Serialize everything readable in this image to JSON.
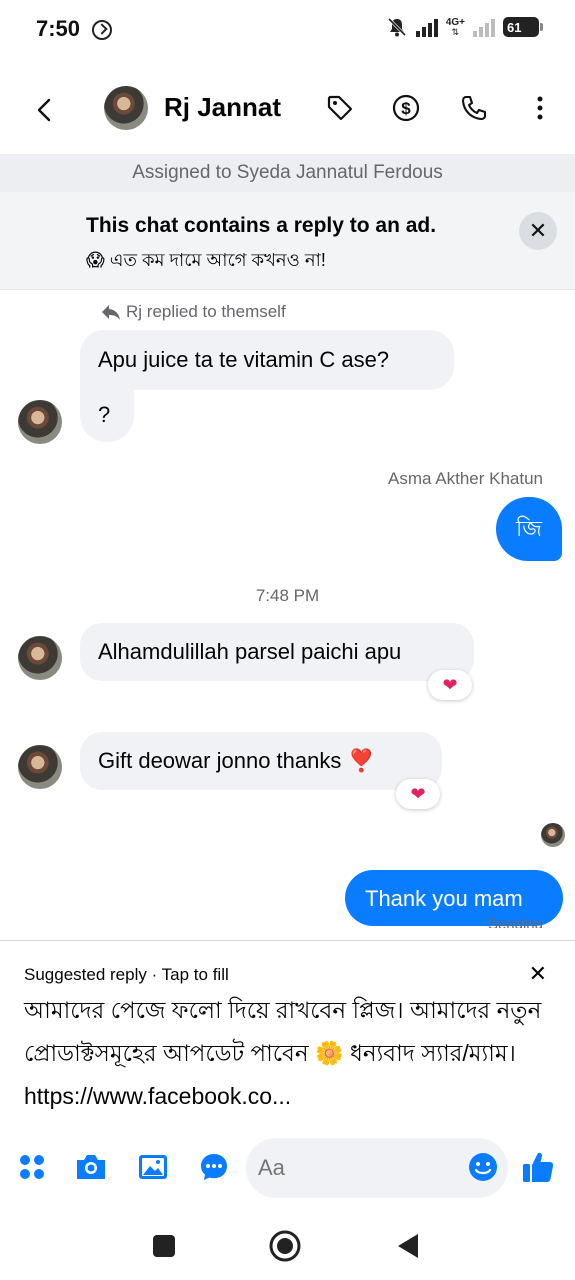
{
  "status": {
    "time": "7:50",
    "network": "4G+",
    "battery": "61"
  },
  "header": {
    "contact_name": "Rj Jannat",
    "icons": [
      "back-icon",
      "tag-icon",
      "dollar-icon",
      "phone-icon",
      "more-icon"
    ]
  },
  "assigned": "Assigned to Syeda Jannatul Ferdous",
  "ad_banner": {
    "title": "This chat contains a reply to an ad.",
    "subtitle": "😱 এত কম দামে আগে কখনও না!"
  },
  "messages": {
    "reply_note": "Rj replied to themself",
    "m1_line1": "Apu juice ta te vitamin C ase?",
    "m1_line2": "?",
    "sender": "Asma Akther Khatun",
    "m2": "জি",
    "time_sep": "7:48 PM",
    "m3": "Alhamdulillah parsel paichi apu",
    "m4": "Gift deowar jonno thanks ❣️",
    "m5": "Thank you mam",
    "sending": "Sending"
  },
  "suggested": {
    "header": "Suggested reply · Tap to fill",
    "text": "আমাদের পেজে ফলো দিয়ে রাখবেন প্লিজ। আমাদের নতুন প্রোডাক্টসমূহের আপডেট পাবেন 🌼 ধন্যবাদ স্যার/ম্যাম। https://www.facebook.co..."
  },
  "composer": {
    "placeholder": "Aa"
  },
  "colors": {
    "accent": "#0a7cff",
    "incoming_bubble": "#f0f2f5",
    "meta_text": "#65676b"
  }
}
